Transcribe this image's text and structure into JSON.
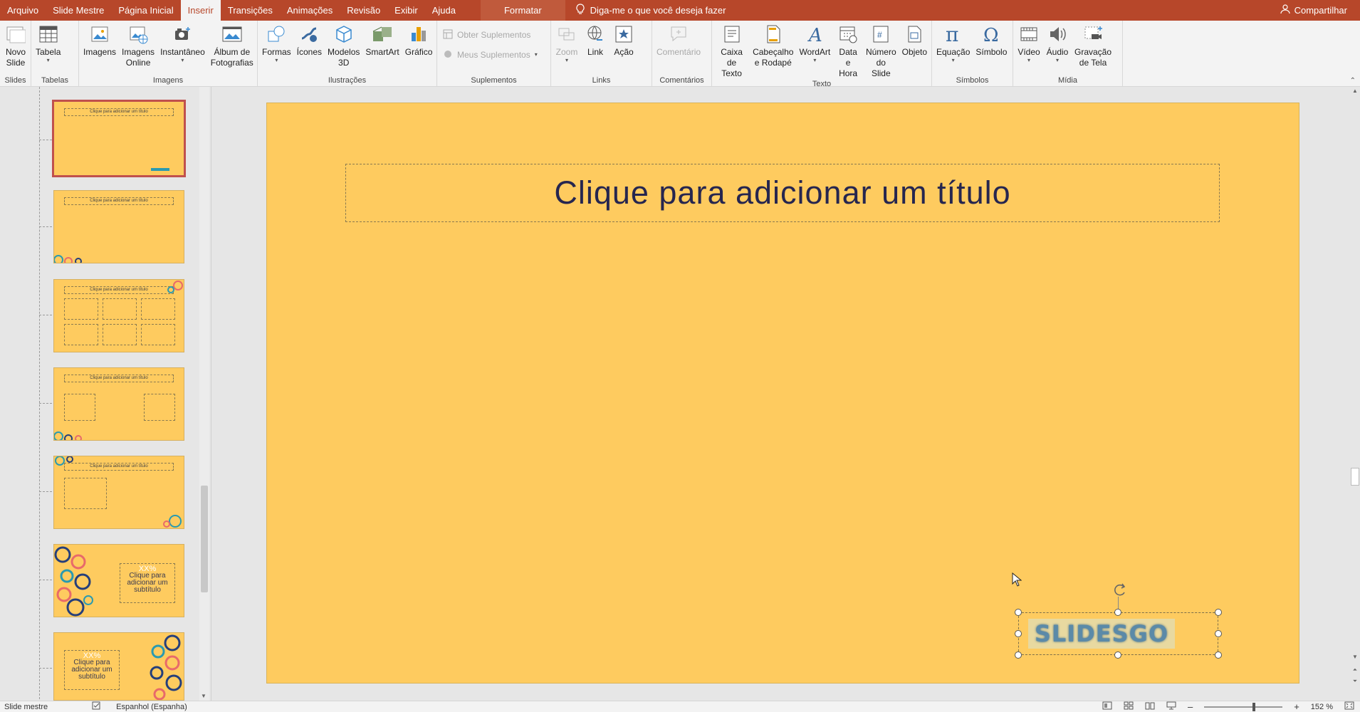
{
  "tabs": [
    {
      "label": "Arquivo"
    },
    {
      "label": "Slide Mestre"
    },
    {
      "label": "Página Inicial"
    },
    {
      "label": "Inserir",
      "active": true
    },
    {
      "label": "Transições"
    },
    {
      "label": "Animações"
    },
    {
      "label": "Revisão"
    },
    {
      "label": "Exibir"
    },
    {
      "label": "Ajuda"
    }
  ],
  "context_tab": "Formatar",
  "tell_me": "Diga-me o que você deseja fazer",
  "share": "Compartilhar",
  "ribbon": {
    "slides": {
      "label": "Slides",
      "novo_slide": [
        "Novo",
        "Slide"
      ]
    },
    "tabelas": {
      "label": "Tabelas",
      "tabela": "Tabela"
    },
    "imagens": {
      "label": "Imagens",
      "imagens": "Imagens",
      "imagens_online": [
        "Imagens",
        "Online"
      ],
      "instantaneo": "Instantâneo",
      "album": [
        "Álbum de",
        "Fotografias"
      ]
    },
    "ilustracoes": {
      "label": "Ilustrações",
      "formas": "Formas",
      "icones": "Ícones",
      "modelos3d": [
        "Modelos",
        "3D"
      ],
      "smartart": "SmartArt",
      "grafico": "Gráfico"
    },
    "suplementos": {
      "label": "Suplementos",
      "obter": "Obter Suplementos",
      "meus": "Meus Suplementos"
    },
    "links": {
      "label": "Links",
      "zoom": "Zoom",
      "link": "Link",
      "acao": "Ação"
    },
    "comentarios": {
      "label": "Comentários",
      "comentario": "Comentário"
    },
    "texto": {
      "label": "Texto",
      "caixa": [
        "Caixa",
        "de Texto"
      ],
      "cabecalho": [
        "Cabeçalho",
        "e Rodapé"
      ],
      "wordart": "WordArt",
      "data": [
        "Data e",
        "Hora"
      ],
      "numero": [
        "Número",
        "do Slide"
      ],
      "objeto": "Objeto"
    },
    "simbolos": {
      "label": "Símbolos",
      "equacao": "Equação",
      "simbolo": "Símbolo"
    },
    "midia": {
      "label": "Mídia",
      "video": "Vídeo",
      "audio": "Áudio",
      "gravacao": [
        "Gravação",
        "de Tela"
      ]
    }
  },
  "thumbnails": [
    {
      "title": "Clique para adicionar um título"
    },
    {
      "title": "Clique para adicionar um título"
    },
    {
      "title": "Clique para adicionar um título"
    },
    {
      "title": "Clique para adicionar um título"
    },
    {
      "title": "Clique para adicionar um título"
    },
    {
      "title": "Clique para adicionar um subtítulo",
      "heading": "XX%"
    },
    {
      "title": "Clique para adicionar um subtítulo",
      "heading": "XX%"
    }
  ],
  "slide": {
    "title": "Clique para adicionar um título",
    "logo": "SLIDESGO",
    "background": "#fecb5f"
  },
  "status": {
    "mode": "Slide mestre",
    "language": "Espanhol (Espanha)",
    "zoom": "152 %"
  },
  "colors": {
    "accent": "#b7472a",
    "slide_bg": "#fecb5f",
    "title_text": "#26264f"
  }
}
